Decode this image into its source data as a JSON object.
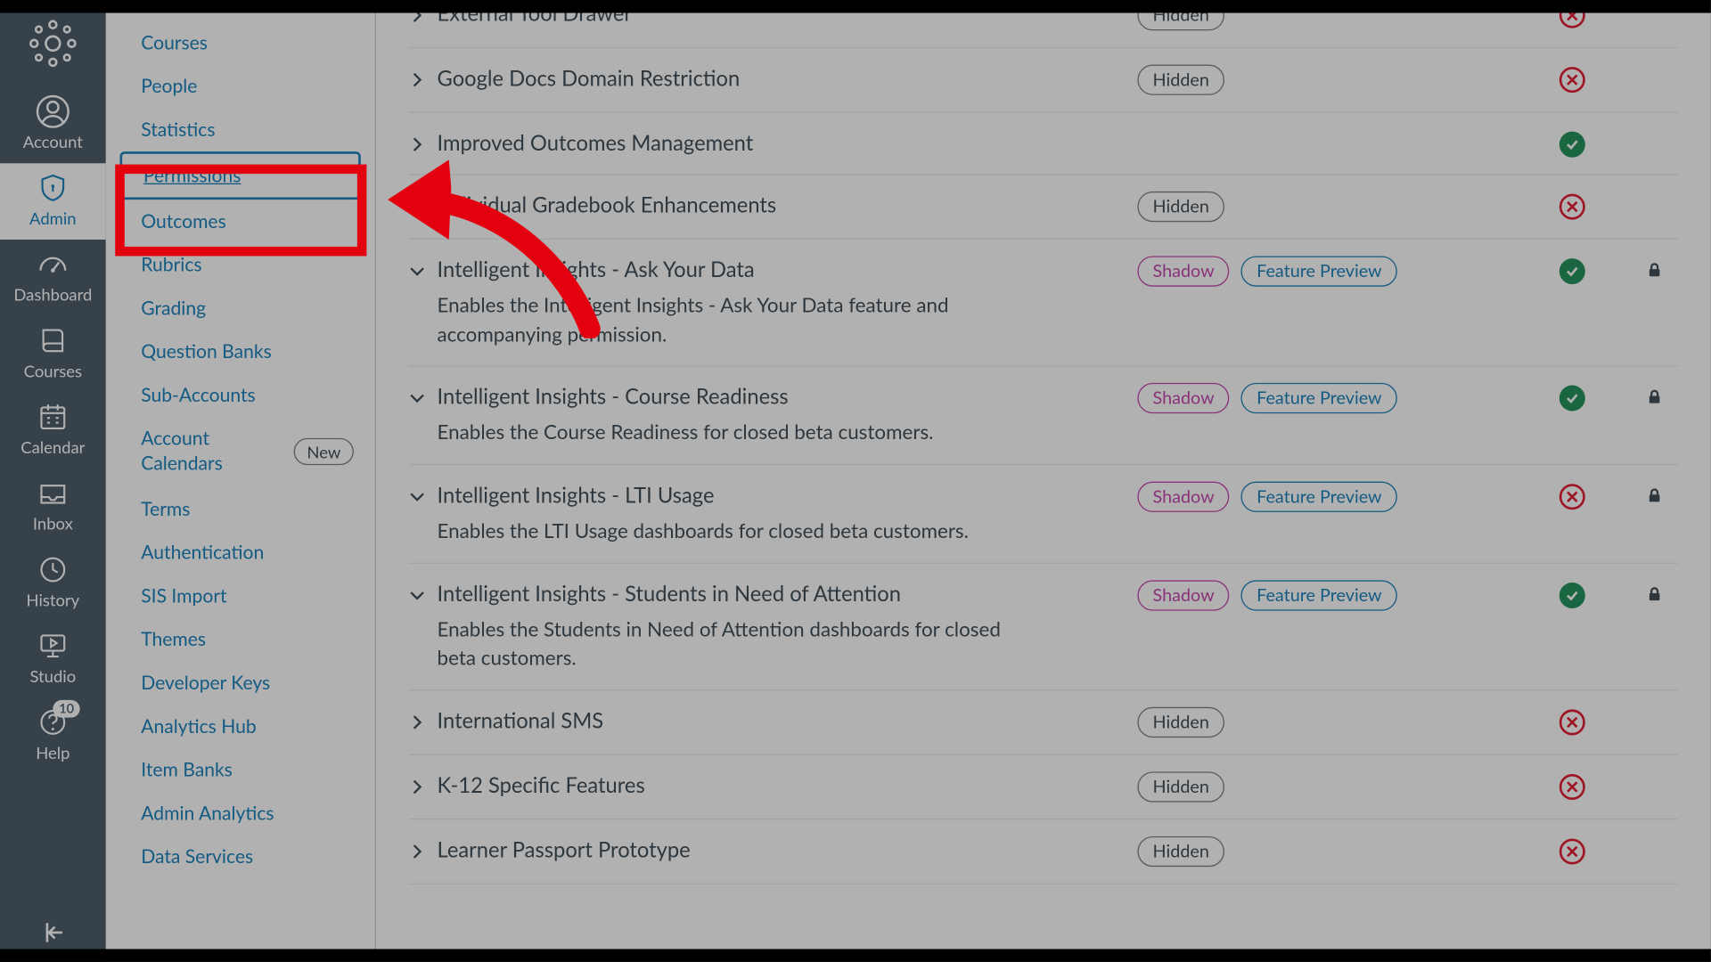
{
  "globalNav": {
    "account": "Account",
    "admin": "Admin",
    "dashboard": "Dashboard",
    "courses": "Courses",
    "calendar": "Calendar",
    "inbox": "Inbox",
    "history": "History",
    "studio": "Studio",
    "help": "Help",
    "help_badge": "10"
  },
  "subNav": {
    "courses": "Courses",
    "people": "People",
    "statistics": "Statistics",
    "permissions": "Permissions",
    "outcomes": "Outcomes",
    "rubrics": "Rubrics",
    "grading": "Grading",
    "question_banks": "Question Banks",
    "sub_accounts": "Sub-Accounts",
    "account_calendars": "Account Calendars",
    "new_pill": "New",
    "terms": "Terms",
    "authentication": "Authentication",
    "sis_import": "SIS Import",
    "themes": "Themes",
    "developer_keys": "Developer Keys",
    "analytics_hub": "Analytics Hub",
    "item_banks": "Item Banks",
    "admin_analytics": "Admin Analytics",
    "data_services": "Data Services"
  },
  "tags": {
    "hidden": "Hidden",
    "shadow": "Shadow",
    "preview": "Feature Preview"
  },
  "features": {
    "f1": {
      "title": "External Tool Drawer"
    },
    "f2": {
      "title": "Google Docs Domain Restriction"
    },
    "f3": {
      "title": "Improved Outcomes Management"
    },
    "f4": {
      "title": "Individual Gradebook Enhancements"
    },
    "f5": {
      "title": "Intelligent Insights - Ask Your Data",
      "desc": "Enables the Intelligent Insights - Ask Your Data feature and accompanying permission."
    },
    "f6": {
      "title": "Intelligent Insights - Course Readiness",
      "desc": "Enables the Course Readiness for closed beta customers."
    },
    "f7": {
      "title": "Intelligent Insights - LTI Usage",
      "desc": "Enables the LTI Usage dashboards for closed beta customers."
    },
    "f8": {
      "title": "Intelligent Insights - Students in Need of Attention",
      "desc": "Enables the Students in Need of Attention dashboards for closed beta customers."
    },
    "f9": {
      "title": "International SMS"
    },
    "f10": {
      "title": "K-12 Specific Features"
    },
    "f11": {
      "title": "Learner Passport Prototype"
    }
  }
}
